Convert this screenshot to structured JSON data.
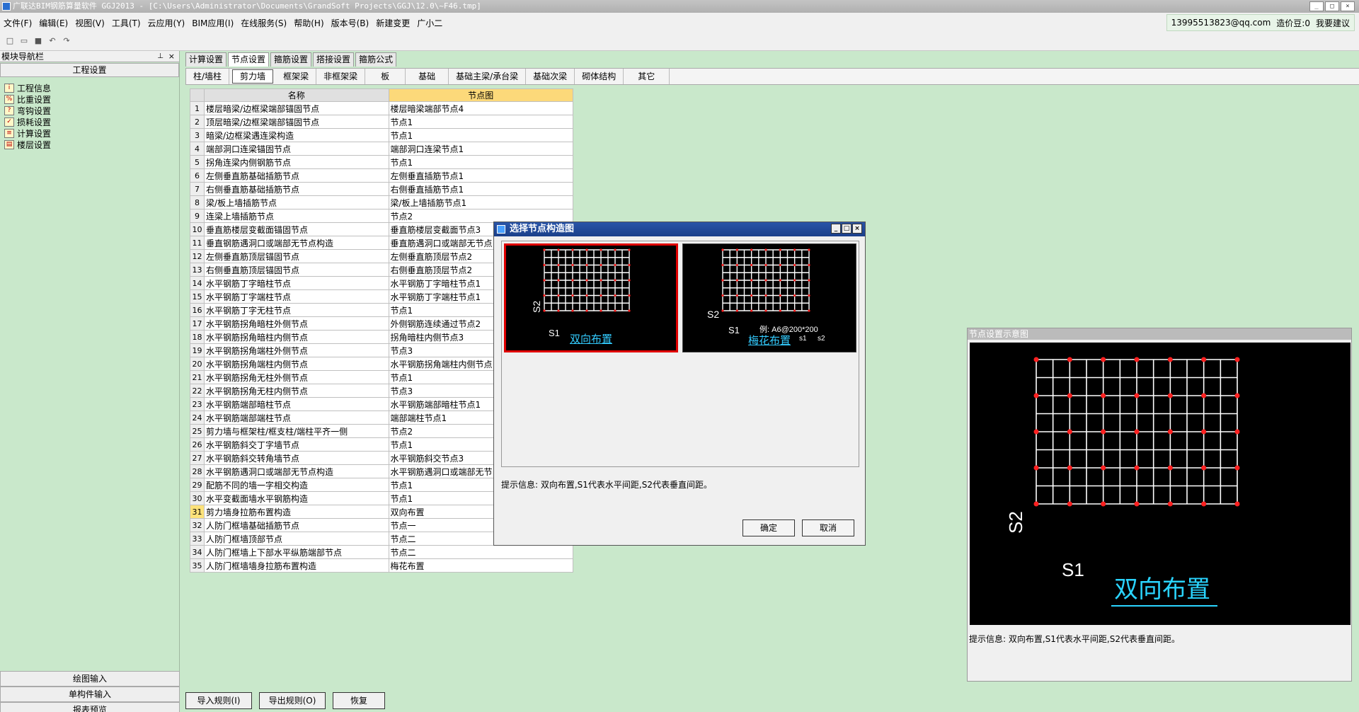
{
  "window": {
    "title": "广联达BIM钢筋算量软件 GGJ2013 - [C:\\Users\\Administrator\\Documents\\GrandSoft Projects\\GGJ\\12.0\\~F46.tmp]"
  },
  "menu": {
    "items": [
      "文件(F)",
      "编辑(E)",
      "视图(V)",
      "工具(T)",
      "云应用(Y)",
      "BIM应用(I)",
      "在线服务(S)",
      "帮助(H)",
      "版本号(B)",
      "新建变更",
      "广小二"
    ],
    "account": "13995513823@qq.com",
    "price_bean": "造价豆:0",
    "suggest": "我要建议"
  },
  "left_panel": {
    "title": "模块导航栏",
    "section": "工程设置",
    "tree": [
      "工程信息",
      "比重设置",
      "弯钩设置",
      "损耗设置",
      "计算设置",
      "楼层设置"
    ],
    "bottom": [
      "绘图输入",
      "单构件输入",
      "报表预览"
    ]
  },
  "tabs_top": [
    "计算设置",
    "节点设置",
    "箍筋设置",
    "搭接设置",
    "箍筋公式"
  ],
  "tabs_sub": [
    "柱/墙柱",
    "剪力墙",
    "框架梁",
    "非框架梁",
    "板",
    "基础",
    "基础主梁/承台梁",
    "基础次梁",
    "砌体结构",
    "其它"
  ],
  "table": {
    "headers": [
      "名称",
      "节点图"
    ],
    "rows": [
      [
        "1",
        "楼层暗梁/边框梁端部锚固节点",
        "楼层暗梁端部节点4"
      ],
      [
        "2",
        "顶层暗梁/边框梁端部锚固节点",
        "节点1"
      ],
      [
        "3",
        "暗梁/边框梁遇连梁构造",
        "节点1"
      ],
      [
        "4",
        "端部洞口连梁锚固节点",
        "端部洞口连梁节点1"
      ],
      [
        "5",
        "拐角连梁内侧钢筋节点",
        "节点1"
      ],
      [
        "6",
        "左侧垂直筋基础插筋节点",
        "左侧垂直插筋节点1"
      ],
      [
        "7",
        "右侧垂直筋基础插筋节点",
        "右侧垂直插筋节点1"
      ],
      [
        "8",
        "梁/板上墙插筋节点",
        "梁/板上墙插筋节点1"
      ],
      [
        "9",
        "连梁上墙插筋节点",
        "节点2"
      ],
      [
        "10",
        "垂直筋楼层变截面锚固节点",
        "垂直筋楼层变截面节点3"
      ],
      [
        "11",
        "垂直钢筋遇洞口或端部无节点构造",
        "垂直筋遇洞口或端部无节点"
      ],
      [
        "12",
        "左侧垂直筋顶层锚固节点",
        "左侧垂直筋顶层节点2"
      ],
      [
        "13",
        "右侧垂直筋顶层锚固节点",
        "右侧垂直筋顶层节点2"
      ],
      [
        "14",
        "水平钢筋丁字暗柱节点",
        "水平钢筋丁字暗柱节点1"
      ],
      [
        "15",
        "水平钢筋丁字端柱节点",
        "水平钢筋丁字端柱节点1"
      ],
      [
        "16",
        "水平钢筋丁字无柱节点",
        "节点1"
      ],
      [
        "17",
        "水平钢筋拐角暗柱外侧节点",
        "外侧钢筋连续通过节点2"
      ],
      [
        "18",
        "水平钢筋拐角暗柱内侧节点",
        "拐角暗柱内侧节点3"
      ],
      [
        "19",
        "水平钢筋拐角端柱外侧节点",
        "节点3"
      ],
      [
        "20",
        "水平钢筋拐角端柱内侧节点",
        "水平钢筋拐角端柱内侧节点"
      ],
      [
        "21",
        "水平钢筋拐角无柱外侧节点",
        "节点1"
      ],
      [
        "22",
        "水平钢筋拐角无柱内侧节点",
        "节点3"
      ],
      [
        "23",
        "水平钢筋端部暗柱节点",
        "水平钢筋端部暗柱节点1"
      ],
      [
        "24",
        "水平钢筋端部端柱节点",
        "端部端柱节点1"
      ],
      [
        "25",
        "剪力墙与框架柱/框支柱/端柱平齐一侧",
        "节点2"
      ],
      [
        "26",
        "水平钢筋斜交丁字墙节点",
        "节点1"
      ],
      [
        "27",
        "水平钢筋斜交转角墙节点",
        "水平钢筋斜交节点3"
      ],
      [
        "28",
        "水平钢筋遇洞口或端部无节点构造",
        "水平钢筋遇洞口或端部无节"
      ],
      [
        "29",
        "配筋不同的墙一字相交构造",
        "节点1"
      ],
      [
        "30",
        "水平变截面墙水平钢筋构造",
        "节点1"
      ],
      [
        "31",
        "剪力墙身拉筋布置构造",
        "双向布置"
      ],
      [
        "32",
        "人防门框墙基础插筋节点",
        "节点一"
      ],
      [
        "33",
        "人防门框墙顶部节点",
        "节点二"
      ],
      [
        "34",
        "人防门框墙上下部水平纵筋端部节点",
        "节点二"
      ],
      [
        "35",
        "人防门框墙墙身拉筋布置构造",
        "梅花布置"
      ]
    ]
  },
  "dialog": {
    "title": "选择节点构造图",
    "options": [
      "双向布置",
      "梅花布置"
    ],
    "example": "例: A6@200*200",
    "s_labels": [
      "S1",
      "S2"
    ],
    "s_small": [
      "s1",
      "s2"
    ],
    "hint": "提示信息: 双向布置,S1代表水平间距,S2代表垂直间距。",
    "ok": "确定",
    "cancel": "取消"
  },
  "preview": {
    "title": "节点设置示意图",
    "caption": "双向布置",
    "s1": "S1",
    "s2": "S2",
    "hint": "提示信息: 双向布置,S1代表水平间距,S2代表垂直间距。"
  },
  "bottom_buttons": [
    "导入规则(I)",
    "导出规则(O)",
    "恢复"
  ],
  "colors": {
    "background": "#c9e8cb",
    "dialog_title": "#1a3f8a",
    "selected_border": "#e00000",
    "caption_cyan": "#33ccff",
    "header_yellow": "#fcd97a"
  }
}
